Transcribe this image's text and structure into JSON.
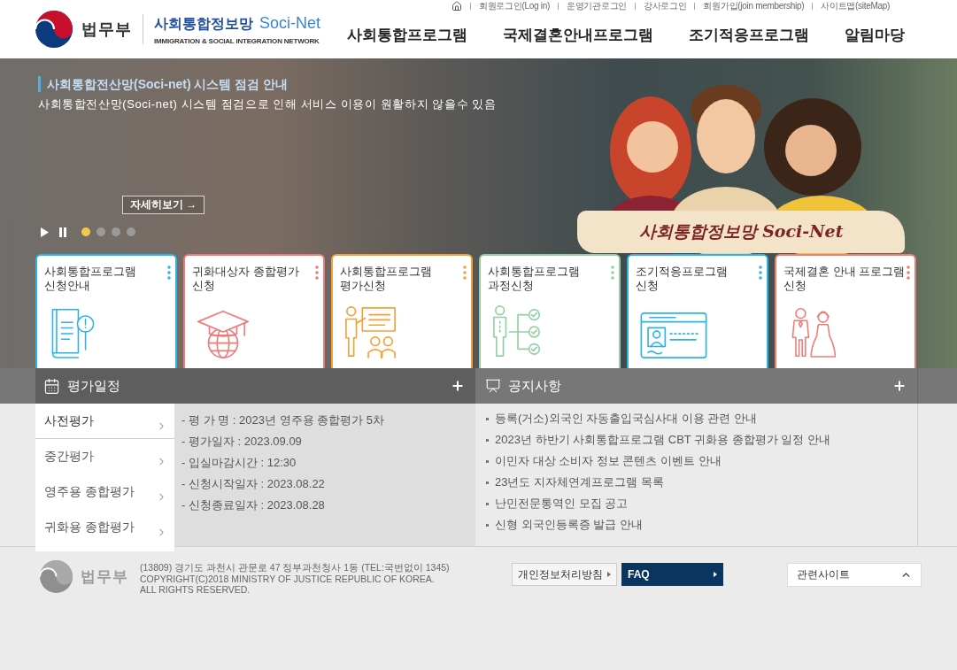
{
  "header": {
    "utility_links": [
      "회원로그인(Log in)",
      "운영기관로그인",
      "강사로그인",
      "회원가입(join membership)",
      "사이트맵(siteMap)"
    ],
    "logo": {
      "org": "법무부",
      "title": "사회통합정보망",
      "brand": "Soci-Net",
      "subtitle": "IMMIGRATION & SOCIAL INTEGRATION NETWORK"
    },
    "nav": [
      "사회통합프로그램",
      "국제결혼안내프로그램",
      "조기적응프로그램",
      "알림마당"
    ]
  },
  "banner": {
    "title": "사회통합전산망(Soci-net) 시스템 점검 안내",
    "text": "사회통합전산망(Soci-net) 시스템 점검으로 인해 서비스 이용이 원활하지 않을수 있음",
    "more_button": "자세히보기 →",
    "slides": [
      {
        "selected": true
      },
      {
        "selected": false
      },
      {
        "selected": false
      },
      {
        "selected": false
      }
    ],
    "illustration_caption": "사회통합정보망 Soci-Net"
  },
  "cards": [
    {
      "title": "사회통합프로그램\n신청안내",
      "color": "#2ab4e6"
    },
    {
      "title": "귀화대상자 종합평가\n신청",
      "color": "#ee7b7b"
    },
    {
      "title": "사회통합프로그램\n평가신청",
      "color": "#f0a236"
    },
    {
      "title": "사회통합프로그램\n과정신청",
      "color": "#93cfa1"
    },
    {
      "title": "조기적응프로그램\n신청",
      "color": "#2ab4e6"
    },
    {
      "title": "국제결혼 안내 프로그램\n신청",
      "color": "#ee7b7b"
    }
  ],
  "schedule": {
    "title": "평가일정",
    "tabs": [
      {
        "label": "사전평가",
        "selected": true
      },
      {
        "label": "중간평가",
        "selected": false
      },
      {
        "label": "영주용 종합평가",
        "selected": false
      },
      {
        "label": "귀화용 종합평가",
        "selected": false
      }
    ],
    "details": [
      "- 평 가 명 : 2023년 영주용 종합평가 5차",
      "- 평가일자 : 2023.09.09",
      "- 입실마감시간 : 12:30",
      "- 신청시작일자 : 2023.08.22",
      "- 신청종료일자 : 2023.08.28"
    ]
  },
  "notices": {
    "title": "공지사항",
    "items": [
      "등록(거소)외국인 자동출입국심사대 이용 관련 안내",
      "2023년 하반기 사회통합프로그램 CBT 귀화용 종합평가 일정 안내",
      "이민자 대상 소비자 정보 콘텐츠 이벤트 안내",
      "23년도 지자체연계프로그램 목록",
      "난민전문통역인 모집 공고",
      "신형 외국인등록증 발급 안내"
    ]
  },
  "footer": {
    "org": "법무부",
    "address": "(13809) 경기도 과천시 관문로 47 정부과천청사 1동 (TEL:국번없이 1345)",
    "copyright": "COPYRIGHT(C)2018 MINISTRY OF JUSTICE REPUBLIC OF KOREA.\nALL RIGHTS RESERVED.",
    "links": [
      {
        "label": "개인정보처리방침",
        "kind": "plain"
      },
      {
        "label": "FAQ",
        "kind": "primary"
      }
    ],
    "related_sites": "관련사이트"
  }
}
